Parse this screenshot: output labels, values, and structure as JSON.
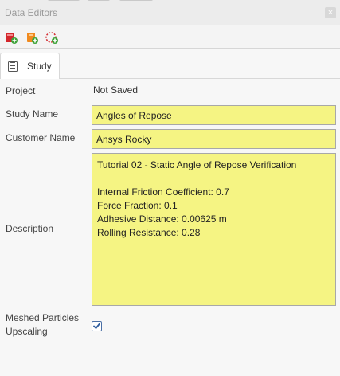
{
  "window": {
    "title": "Data Editors",
    "close_icon": "close-icon"
  },
  "toolbar": {
    "icons": [
      "remove-study-icon",
      "add-study-icon",
      "new-study-icon"
    ]
  },
  "tabs": [
    {
      "label": "Study",
      "icon": "clipboard-icon",
      "active": true
    }
  ],
  "form": {
    "project": {
      "label": "Project",
      "value": "Not Saved"
    },
    "study_name": {
      "label": "Study Name",
      "value": "Angles of Repose"
    },
    "customer_name": {
      "label": "Customer Name",
      "value": "Ansys Rocky"
    },
    "description": {
      "label": "Description",
      "lines": [
        "Tutorial 02 - Static Angle of Repose Verification",
        "",
        "Internal Friction Coefficient: 0.7",
        "Force Fraction: 0.1",
        "Adhesive Distance: 0.00625 m",
        "Rolling Resistance: 0.28"
      ]
    },
    "meshed_particles_upscaling": {
      "label_line1": "Meshed Particles",
      "label_line2": "Upscaling",
      "checked": true
    }
  },
  "colors": {
    "field_background": "#f5f483",
    "panel_background": "#f7f7f7",
    "checkbox_accent": "#2f5d9e"
  }
}
